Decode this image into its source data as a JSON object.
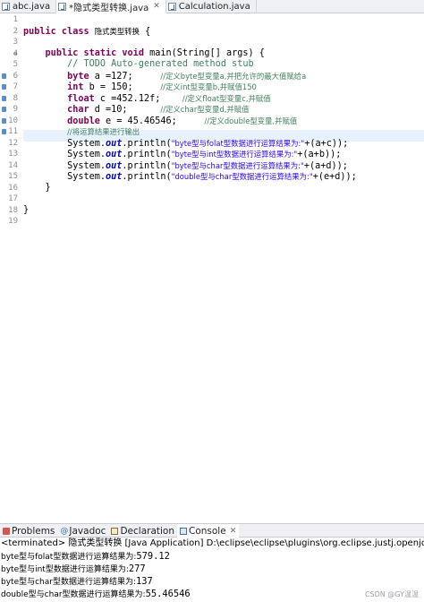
{
  "tabs": [
    {
      "label": "abc.java"
    },
    {
      "label": "*隐式类型转换.java",
      "active": true
    },
    {
      "label": "Calculation.java"
    }
  ],
  "editor": {
    "line_numbers": [
      "1",
      "2",
      "3",
      "4",
      "5",
      "6",
      "7",
      "8",
      "9",
      "10",
      "11",
      "12",
      "13",
      "14",
      "15",
      "16",
      "17",
      "18",
      "19"
    ],
    "class_name": "隐式类型转换",
    "main_sig": "main(String[] args) {",
    "todo": "// TODO Auto-generated method stub",
    "l6_code": " a =127;",
    "l6_cmt": "//定义byte型变量a,并把允许的最大值赋给a",
    "l7_code": " b = 150;",
    "l7_cmt": "//定义int型变量b,并赋值150",
    "l8_code": " c =452.12f;",
    "l8_cmt": "//定义float型变量c,并赋值",
    "l9_code": " d =10;",
    "l9_cmt": "//定义char型变量d,并赋值",
    "l10_code": " e = 45.46546;",
    "l10_cmt": "//定义double型变量,并赋值",
    "l11_cmt": "//将运算结果进行输出",
    "p1": "\"byte型与folat型数据进行运算结果为:\"",
    "p1_rest": "+(a+c));",
    "p2": "\"byte型与int型数据进行运算结果为:\"",
    "p2_rest": "+(a+b));",
    "p3": "\"byte型与char型数据进行运算结果为:\"",
    "p3_rest": "+(a+d));",
    "p4": "\"double型与char型数据进行运算结果为:\"",
    "p4_rest": "+(e+d));"
  },
  "views": {
    "tabs": [
      {
        "label": "Problems"
      },
      {
        "label": "Javadoc"
      },
      {
        "label": "Declaration"
      },
      {
        "label": "Console",
        "active": true
      }
    ]
  },
  "console": {
    "status": "<terminated> 隐式类型转换 [Java Application] D:\\eclipse\\eclipse\\plugins\\org.eclipse.justj.openjdk.h",
    "lines": [
      {
        "label": "byte型与folat型数据进行运算结果为:",
        "value": "579.12"
      },
      {
        "label": "byte型与int型数据进行运算结果为:",
        "value": "277"
      },
      {
        "label": "byte型与char型数据进行运算结果为:",
        "value": "137"
      },
      {
        "label": "double型与char型数据进行运算结果为:",
        "value": "55.46546"
      }
    ]
  },
  "watermark": "CSDN @GY温温",
  "colors": {
    "keyword": "#7f0055",
    "comment": "#3f7f5f",
    "string": "#2a00ff",
    "field": "#0000c0",
    "current_line": "#e8f2fe"
  }
}
